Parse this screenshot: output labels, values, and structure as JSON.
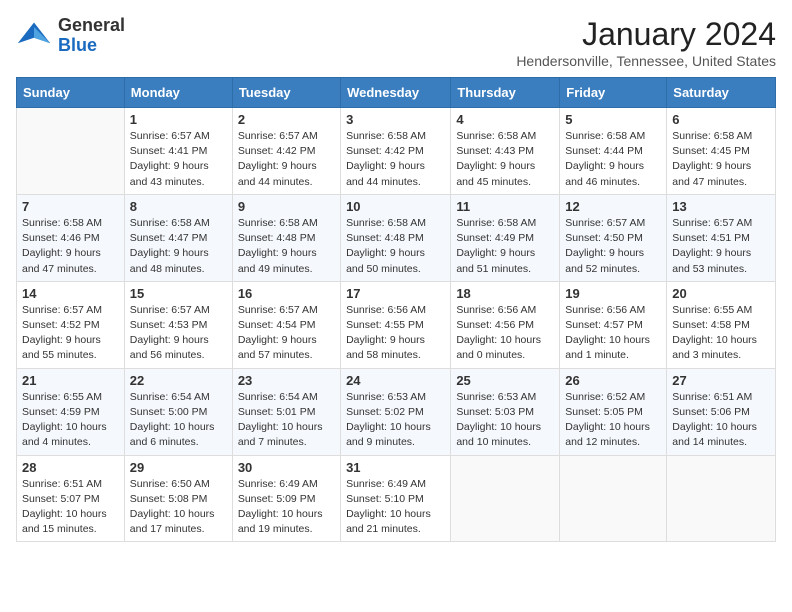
{
  "logo": {
    "general": "General",
    "blue": "Blue"
  },
  "title": "January 2024",
  "subtitle": "Hendersonville, Tennessee, United States",
  "days_header": [
    "Sunday",
    "Monday",
    "Tuesday",
    "Wednesday",
    "Thursday",
    "Friday",
    "Saturday"
  ],
  "weeks": [
    [
      {
        "num": "",
        "info": ""
      },
      {
        "num": "1",
        "info": "Sunrise: 6:57 AM\nSunset: 4:41 PM\nDaylight: 9 hours\nand 43 minutes."
      },
      {
        "num": "2",
        "info": "Sunrise: 6:57 AM\nSunset: 4:42 PM\nDaylight: 9 hours\nand 44 minutes."
      },
      {
        "num": "3",
        "info": "Sunrise: 6:58 AM\nSunset: 4:42 PM\nDaylight: 9 hours\nand 44 minutes."
      },
      {
        "num": "4",
        "info": "Sunrise: 6:58 AM\nSunset: 4:43 PM\nDaylight: 9 hours\nand 45 minutes."
      },
      {
        "num": "5",
        "info": "Sunrise: 6:58 AM\nSunset: 4:44 PM\nDaylight: 9 hours\nand 46 minutes."
      },
      {
        "num": "6",
        "info": "Sunrise: 6:58 AM\nSunset: 4:45 PM\nDaylight: 9 hours\nand 47 minutes."
      }
    ],
    [
      {
        "num": "7",
        "info": "Sunrise: 6:58 AM\nSunset: 4:46 PM\nDaylight: 9 hours\nand 47 minutes."
      },
      {
        "num": "8",
        "info": "Sunrise: 6:58 AM\nSunset: 4:47 PM\nDaylight: 9 hours\nand 48 minutes."
      },
      {
        "num": "9",
        "info": "Sunrise: 6:58 AM\nSunset: 4:48 PM\nDaylight: 9 hours\nand 49 minutes."
      },
      {
        "num": "10",
        "info": "Sunrise: 6:58 AM\nSunset: 4:48 PM\nDaylight: 9 hours\nand 50 minutes."
      },
      {
        "num": "11",
        "info": "Sunrise: 6:58 AM\nSunset: 4:49 PM\nDaylight: 9 hours\nand 51 minutes."
      },
      {
        "num": "12",
        "info": "Sunrise: 6:57 AM\nSunset: 4:50 PM\nDaylight: 9 hours\nand 52 minutes."
      },
      {
        "num": "13",
        "info": "Sunrise: 6:57 AM\nSunset: 4:51 PM\nDaylight: 9 hours\nand 53 minutes."
      }
    ],
    [
      {
        "num": "14",
        "info": "Sunrise: 6:57 AM\nSunset: 4:52 PM\nDaylight: 9 hours\nand 55 minutes."
      },
      {
        "num": "15",
        "info": "Sunrise: 6:57 AM\nSunset: 4:53 PM\nDaylight: 9 hours\nand 56 minutes."
      },
      {
        "num": "16",
        "info": "Sunrise: 6:57 AM\nSunset: 4:54 PM\nDaylight: 9 hours\nand 57 minutes."
      },
      {
        "num": "17",
        "info": "Sunrise: 6:56 AM\nSunset: 4:55 PM\nDaylight: 9 hours\nand 58 minutes."
      },
      {
        "num": "18",
        "info": "Sunrise: 6:56 AM\nSunset: 4:56 PM\nDaylight: 10 hours\nand 0 minutes."
      },
      {
        "num": "19",
        "info": "Sunrise: 6:56 AM\nSunset: 4:57 PM\nDaylight: 10 hours\nand 1 minute."
      },
      {
        "num": "20",
        "info": "Sunrise: 6:55 AM\nSunset: 4:58 PM\nDaylight: 10 hours\nand 3 minutes."
      }
    ],
    [
      {
        "num": "21",
        "info": "Sunrise: 6:55 AM\nSunset: 4:59 PM\nDaylight: 10 hours\nand 4 minutes."
      },
      {
        "num": "22",
        "info": "Sunrise: 6:54 AM\nSunset: 5:00 PM\nDaylight: 10 hours\nand 6 minutes."
      },
      {
        "num": "23",
        "info": "Sunrise: 6:54 AM\nSunset: 5:01 PM\nDaylight: 10 hours\nand 7 minutes."
      },
      {
        "num": "24",
        "info": "Sunrise: 6:53 AM\nSunset: 5:02 PM\nDaylight: 10 hours\nand 9 minutes."
      },
      {
        "num": "25",
        "info": "Sunrise: 6:53 AM\nSunset: 5:03 PM\nDaylight: 10 hours\nand 10 minutes."
      },
      {
        "num": "26",
        "info": "Sunrise: 6:52 AM\nSunset: 5:05 PM\nDaylight: 10 hours\nand 12 minutes."
      },
      {
        "num": "27",
        "info": "Sunrise: 6:51 AM\nSunset: 5:06 PM\nDaylight: 10 hours\nand 14 minutes."
      }
    ],
    [
      {
        "num": "28",
        "info": "Sunrise: 6:51 AM\nSunset: 5:07 PM\nDaylight: 10 hours\nand 15 minutes."
      },
      {
        "num": "29",
        "info": "Sunrise: 6:50 AM\nSunset: 5:08 PM\nDaylight: 10 hours\nand 17 minutes."
      },
      {
        "num": "30",
        "info": "Sunrise: 6:49 AM\nSunset: 5:09 PM\nDaylight: 10 hours\nand 19 minutes."
      },
      {
        "num": "31",
        "info": "Sunrise: 6:49 AM\nSunset: 5:10 PM\nDaylight: 10 hours\nand 21 minutes."
      },
      {
        "num": "",
        "info": ""
      },
      {
        "num": "",
        "info": ""
      },
      {
        "num": "",
        "info": ""
      }
    ]
  ]
}
